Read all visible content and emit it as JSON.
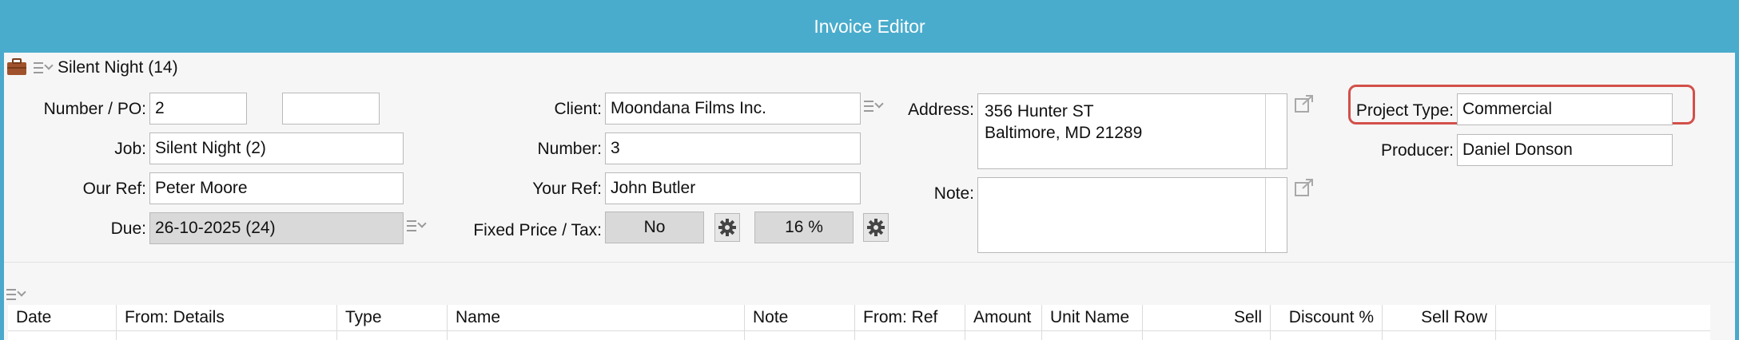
{
  "window": {
    "title": "Invoice Editor"
  },
  "record": {
    "title": "Silent Night (14)"
  },
  "icons": {
    "briefcase": "briefcase-icon",
    "menu": "list-menu-icon",
    "gear": "gear-icon",
    "external": "external-link-icon"
  },
  "colors": {
    "title_bar": "#4aaccc",
    "highlight": "#d3504a"
  },
  "form": {
    "number_po": {
      "label": "Number / PO:",
      "value": "2",
      "value2": ""
    },
    "job": {
      "label": "Job:",
      "value": "Silent Night (2)"
    },
    "our_ref": {
      "label": "Our Ref:",
      "value": "Peter Moore"
    },
    "due": {
      "label": "Due:",
      "value": "26-10-2025 (24)"
    },
    "client": {
      "label": "Client:",
      "value": "Moondana Films Inc."
    },
    "number": {
      "label": "Number:",
      "value": "3"
    },
    "your_ref": {
      "label": "Your Ref:",
      "value": "John Butler"
    },
    "fixed_price_tax": {
      "label": "Fixed Price / Tax:",
      "fixed_price": "No",
      "tax": "16 %"
    },
    "address": {
      "label": "Address:",
      "line1": "356 Hunter ST",
      "line2": "Baltimore, MD 21289"
    },
    "note": {
      "label": "Note:",
      "value": ""
    },
    "project_type": {
      "label": "Project Type:",
      "value": "Commercial"
    },
    "producer": {
      "label": "Producer:",
      "value": "Daniel Donson"
    }
  },
  "table": {
    "columns": [
      "Date",
      "From: Details",
      "Type",
      "Name",
      "Note",
      "From: Ref",
      "Amount",
      "Unit Name",
      "Sell",
      "Discount %",
      "Sell Row"
    ]
  }
}
